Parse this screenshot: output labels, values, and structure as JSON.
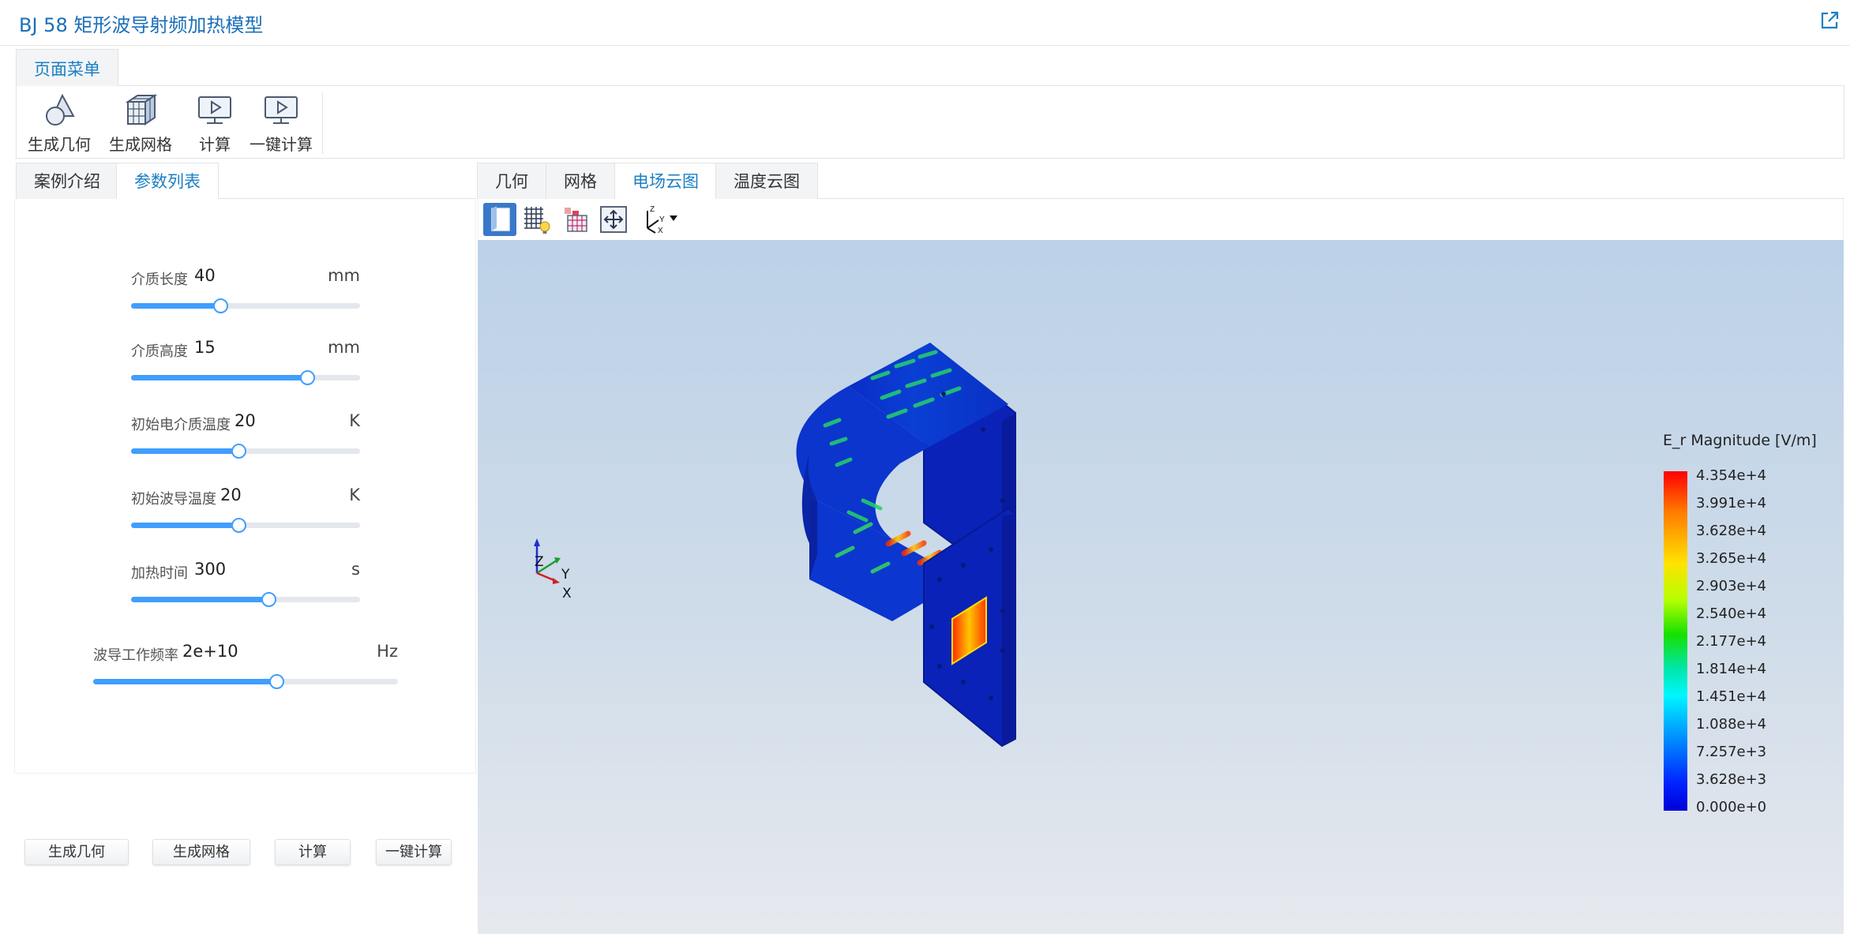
{
  "app": {
    "title": "BJ 58 矩形波导射频加热模型"
  },
  "ribbon": {
    "tab": "页面菜单",
    "buttons": [
      {
        "label": "生成几何",
        "icon": "geometry-icon"
      },
      {
        "label": "生成网格",
        "icon": "mesh-cube-icon"
      },
      {
        "label": "计算",
        "icon": "play-monitor-icon"
      },
      {
        "label": "一键计算",
        "icon": "play-monitor-icon"
      }
    ]
  },
  "left_tabs": [
    {
      "label": "案例介绍",
      "active": false
    },
    {
      "label": "参数列表",
      "active": true
    }
  ],
  "params": [
    {
      "label": "介质长度",
      "value": "40",
      "unit": "mm",
      "fraction": 0.39
    },
    {
      "label": "介质高度",
      "value": "15",
      "unit": "mm",
      "fraction": 0.77
    },
    {
      "label": "初始电介质温度",
      "value": "20",
      "unit": "K",
      "fraction": 0.47
    },
    {
      "label": "初始波导温度",
      "value": "20",
      "unit": "K",
      "fraction": 0.47
    },
    {
      "label": "加热时间",
      "value": "300",
      "unit": "s",
      "fraction": 0.6
    },
    {
      "label": "波导工作频率",
      "value": "2e+10",
      "unit": "Hz",
      "fraction": 0.6
    }
  ],
  "bottom_buttons": [
    {
      "label": "生成几何"
    },
    {
      "label": "生成网格"
    },
    {
      "label": "计算"
    },
    {
      "label": "一键计算"
    }
  ],
  "right_tabs": [
    {
      "label": "几何",
      "active": false
    },
    {
      "label": "网格",
      "active": false
    },
    {
      "label": "电场云图",
      "active": true
    },
    {
      "label": "温度云图",
      "active": false
    }
  ],
  "viewer_toolbar": [
    {
      "icon": "surface-view-icon",
      "active": true
    },
    {
      "icon": "mesh-light-icon",
      "active": false
    },
    {
      "icon": "color-cube-icon",
      "active": false
    },
    {
      "icon": "fit-view-icon",
      "active": false
    },
    {
      "icon": "axis-orientation-icon",
      "active": false
    }
  ],
  "axes": {
    "z": "Z",
    "y": "Y",
    "x": "X"
  },
  "legend": {
    "title": "E_r Magnitude [V/m]",
    "ticks": [
      "4.354e+4",
      "3.991e+4",
      "3.628e+4",
      "3.265e+4",
      "2.903e+4",
      "2.540e+4",
      "2.177e+4",
      "1.814e+4",
      "1.451e+4",
      "1.088e+4",
      "7.257e+3",
      "3.628e+3",
      "0.000e+0"
    ],
    "colors": {
      "max": "#ff0000",
      "mid": "#17e000",
      "min": "#0000d8"
    }
  },
  "colors": {
    "accent": "#1b7fc4",
    "slider": "#409eff"
  }
}
